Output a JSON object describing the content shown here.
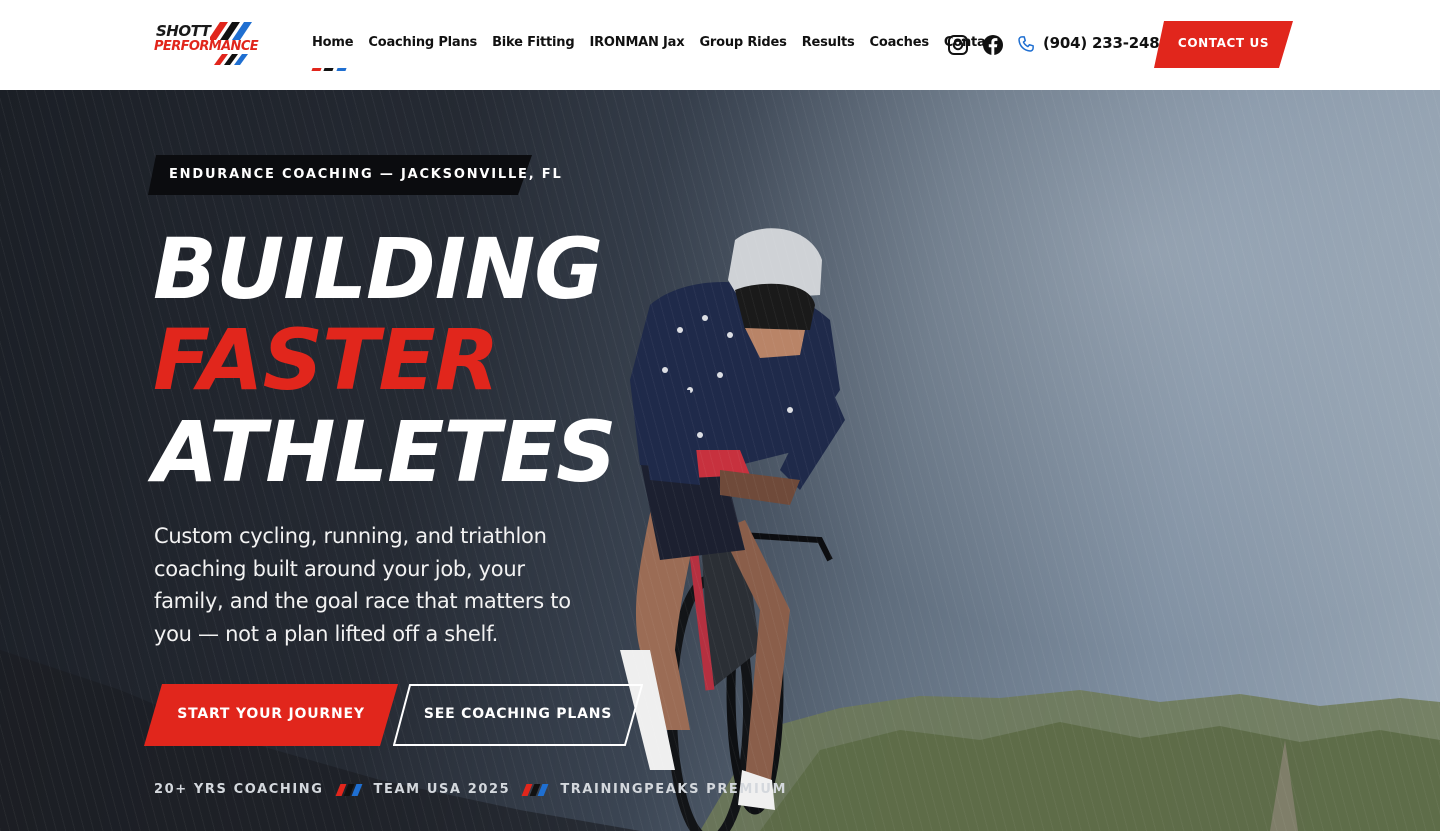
{
  "brand": {
    "logo_line1": "SHOTT",
    "logo_line2": "PERFORMANCE",
    "colors": {
      "red": "#e1261c",
      "blue": "#1f6fd1",
      "dark": "#111111"
    }
  },
  "nav": {
    "items": [
      {
        "label": "Home",
        "active": true
      },
      {
        "label": "Coaching Plans",
        "active": false
      },
      {
        "label": "Bike Fitting",
        "active": false
      },
      {
        "label": "IRONMAN Jax",
        "active": false
      },
      {
        "label": "Group Rides",
        "active": false
      },
      {
        "label": "Results",
        "active": false
      },
      {
        "label": "Coaches",
        "active": false
      },
      {
        "label": "Contact",
        "active": false
      }
    ]
  },
  "header": {
    "social_icons": [
      "instagram-icon",
      "facebook-icon"
    ],
    "phone_icon": "phone-icon",
    "phone": "(904) 233-2483",
    "contact_label": "CONTACT US"
  },
  "hero": {
    "eyebrow": "ENDURANCE COACHING — JACKSONVILLE, FL",
    "headline": [
      "BUILDING",
      "FASTER",
      "ATHLETES"
    ],
    "subtext": "Custom cycling, running, and triathlon coaching built around your job, your family, and the goal race that matters to you — not a plan lifted off a shelf.",
    "primary_cta": "START YOUR JOURNEY",
    "secondary_cta": "SEE COACHING PLANS",
    "stats": [
      "20+ YRS COACHING",
      "TEAM USA 2025",
      "TRAININGPEAKS PREMIUM"
    ]
  }
}
